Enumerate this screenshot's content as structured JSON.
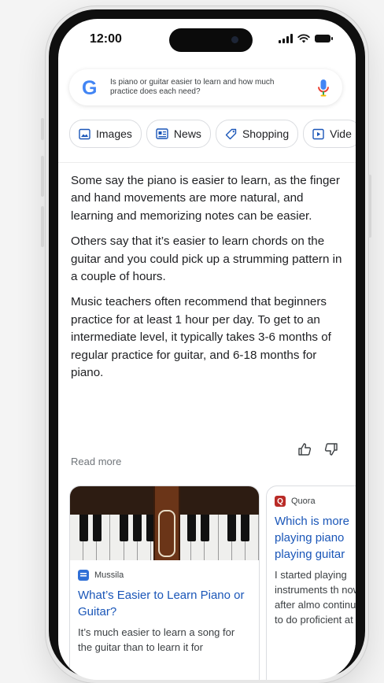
{
  "status": {
    "time": "12:00"
  },
  "search": {
    "logo": "G",
    "query": "Is piano or guitar easier to learn and how much practice does each need?"
  },
  "chips": [
    {
      "label": "Images",
      "icon": "image-icon"
    },
    {
      "label": "News",
      "icon": "news-icon"
    },
    {
      "label": "Shopping",
      "icon": "tag-icon"
    },
    {
      "label": "Vide",
      "icon": "video-icon"
    }
  ],
  "answer": {
    "paragraphs": [
      "Some say the piano is easier to learn, as the finger and hand movements are more natural, and learning and memorizing notes can be easier.",
      "Others say that it’s easier to learn chords on the guitar and you could pick up a strumming pattern in a couple of hours.",
      "Music teachers often recommend that beginners practice for at least 1 hour per day. To get to an intermediate level, it typically takes 3-6 months of regular practice for guitar, and 6-18 months for piano."
    ],
    "read_more": "Read more"
  },
  "cards": [
    {
      "source": "Mussila",
      "source_color": "#2f6fd6",
      "title": "What’s Easier to Learn Piano or Guitar?",
      "snippet": "It’s much easier to learn a song for the guitar than to learn it for"
    },
    {
      "source": "Quora",
      "source_color": "#b92b27",
      "source_letter": "Q",
      "title": "Which is more playing piano playing guitar",
      "snippet": "I started playing instruments th now, after almo continue to do proficient at"
    }
  ],
  "colors": {
    "link_blue": "#1a56b8",
    "google_blue": "#4285f4"
  }
}
